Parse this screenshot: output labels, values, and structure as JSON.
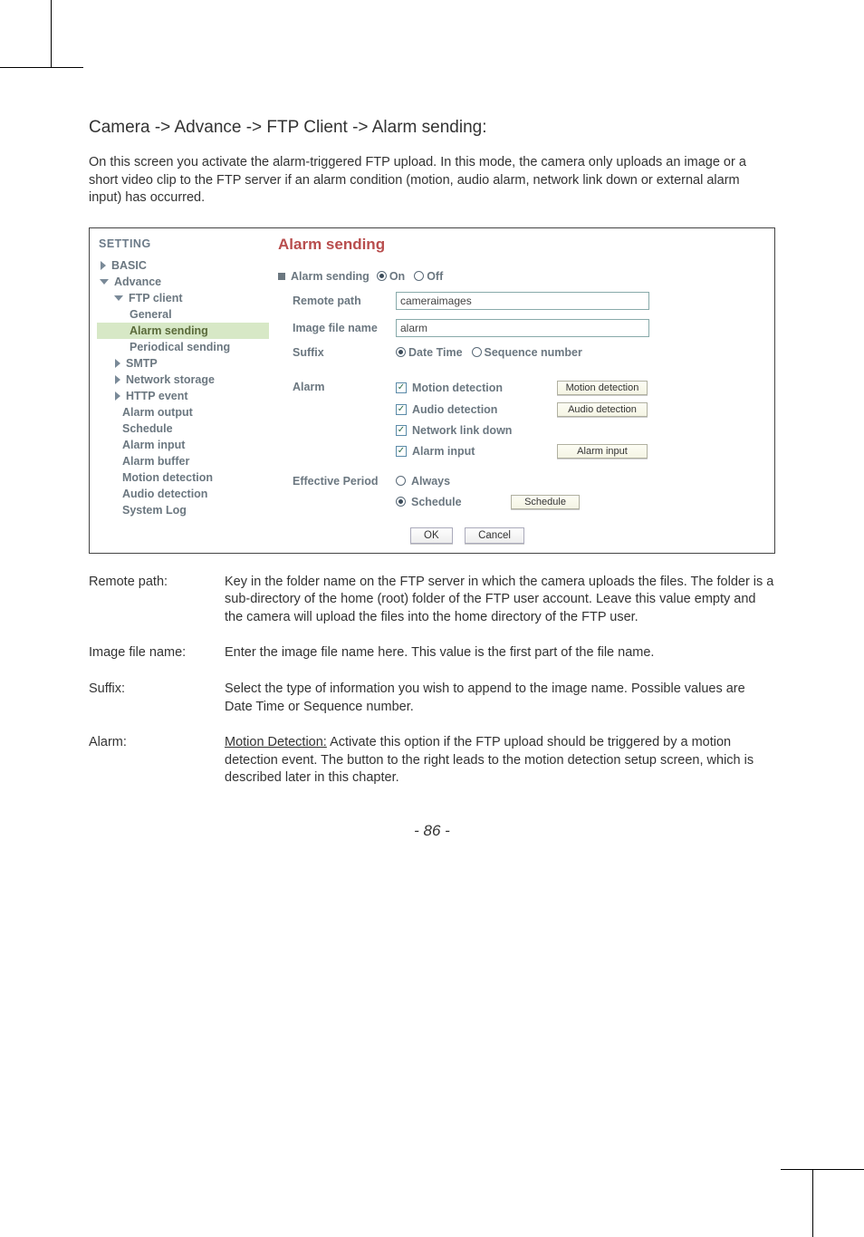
{
  "heading": "Camera -> Advance -> FTP Client -> Alarm sending:",
  "intro": "On this screen you activate the alarm-triggered FTP upload. In this mode, the camera only uploads an image or a short video clip to the FTP server if an alarm condition (motion, audio alarm, network link down or external alarm input) has occurred.",
  "sidebar": {
    "title": "SETTING",
    "basic": "BASIC",
    "advance": "Advance",
    "ftp_client": "FTP client",
    "general": "General",
    "alarm_sending": "Alarm sending",
    "periodical_sending": "Periodical sending",
    "smtp": "SMTP",
    "network_storage": "Network storage",
    "http_event": "HTTP event",
    "alarm_output": "Alarm output",
    "schedule": "Schedule",
    "alarm_input": "Alarm input",
    "alarm_buffer": "Alarm buffer",
    "motion_detection": "Motion detection",
    "audio_detection": "Audio detection",
    "system_log": "System Log"
  },
  "pane": {
    "title": "Alarm sending",
    "sending_label": "Alarm sending",
    "on": "On",
    "off": "Off",
    "remote_path_label": "Remote path",
    "remote_path_value": "cameraimages",
    "image_file_name_label": "Image file name",
    "image_file_name_value": "alarm",
    "suffix_label": "Suffix",
    "suffix_date": "Date Time",
    "suffix_seq": "Sequence number",
    "alarm_label": "Alarm",
    "motion_detection": "Motion detection",
    "motion_detection_btn": "Motion detection",
    "audio_detection": "Audio detection",
    "audio_detection_btn": "Audio detection",
    "network_link_down": "Network link down",
    "alarm_input": "Alarm input",
    "alarm_input_btn": "Alarm input",
    "effective_period_label": "Effective Period",
    "always": "Always",
    "schedule": "Schedule",
    "schedule_btn": "Schedule",
    "ok": "OK",
    "cancel": "Cancel"
  },
  "defs": {
    "remote_path_term": "Remote path:",
    "remote_path_body": "Key in the folder name on the FTP server in which the camera uploads the files. The folder is a sub-directory of the home (root) folder of the FTP user account. Leave this value empty and the camera will upload the files into the home directory of the FTP user.",
    "image_file_name_term": "Image file name:",
    "image_file_name_body": "Enter the image file name here. This value is the first part of the file name.",
    "suffix_term": "Suffix:",
    "suffix_body": "Select the type of information you wish to append to the image name. Possible values are Date Time or Sequence number.",
    "alarm_term": "Alarm:",
    "alarm_underline": "Motion Detection:",
    "alarm_body_rest": " Activate this option if the FTP upload should be triggered by a motion detection event. The button to the right leads to the motion detection setup screen, which is described later in this chapter."
  },
  "page_number": "- 86 -"
}
